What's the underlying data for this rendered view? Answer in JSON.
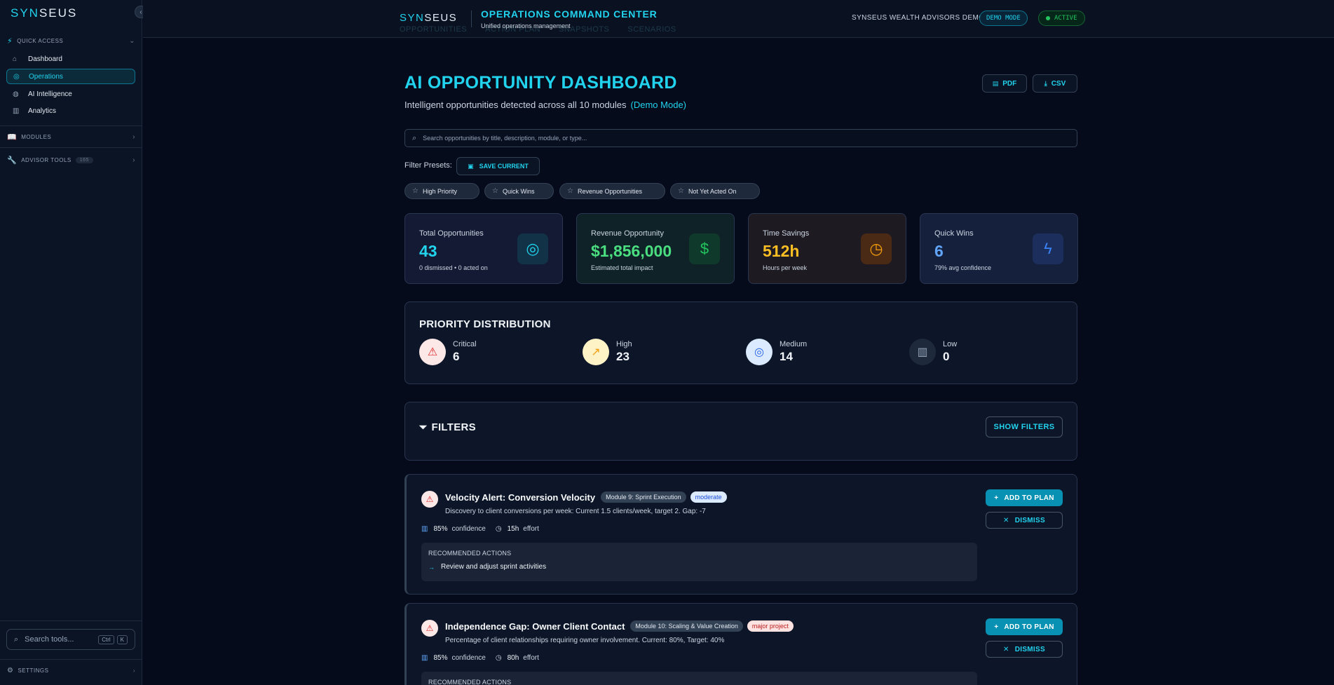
{
  "sidebar": {
    "brand_a": "SYN",
    "brand_b": "SEUS",
    "quick_access": "QUICK ACCESS",
    "items": [
      {
        "label": "Dashboard",
        "icon": "home-icon"
      },
      {
        "label": "Operations",
        "icon": "target-icon",
        "active": true
      },
      {
        "label": "AI Intelligence",
        "icon": "brain-icon"
      },
      {
        "label": "Analytics",
        "icon": "bar-chart-icon"
      }
    ],
    "modules": "MODULES",
    "advisor_tools": "ADVISOR TOOLS",
    "advisor_tools_count": "165",
    "search_placeholder": "Search tools...",
    "kbd_ctrl": "Ctrl",
    "kbd_k": "K",
    "settings": "SETTINGS"
  },
  "topbar": {
    "brand_a": "SYN",
    "brand_b": "SEUS",
    "title": "OPERATIONS COMMAND CENTER",
    "subtitle": "Unified operations management",
    "ghost_tabs": [
      "OPPORTUNITIES",
      "ACTION PLAN",
      "SNAPSHOTS",
      "SCENARIOS"
    ],
    "org_name": "SYNSEUS WEALTH ADVISORS DEMO",
    "demo_mode": "DEMO MODE",
    "status": "ACTIVE"
  },
  "main": {
    "title": "AI OPPORTUNITY DASHBOARD",
    "subtitle": "Intelligent opportunities detected across all 10 modules",
    "demo_tag": "(Demo Mode)",
    "export_pdf": "PDF",
    "export_csv": "CSV",
    "search_placeholder": "Search opportunities by title, description, module, or type...",
    "presets_label": "Filter Presets:",
    "save_current": "SAVE CURRENT",
    "presets": [
      "High Priority",
      "Quick Wins",
      "Revenue Opportunities",
      "Not Yet Acted On"
    ]
  },
  "stats": [
    {
      "label": "Total Opportunities",
      "value": "43",
      "sub": "0 dismissed • 0 acted on",
      "icon": "target-icon"
    },
    {
      "label": "Revenue Opportunity",
      "value": "$1,856,000",
      "sub": "Estimated total impact",
      "icon": "dollar-icon"
    },
    {
      "label": "Time Savings",
      "value": "512h",
      "sub": "Hours per week",
      "icon": "clock-icon"
    },
    {
      "label": "Quick Wins",
      "value": "6",
      "sub": "79% avg confidence",
      "icon": "lightning-icon"
    }
  ],
  "priority": {
    "title": "PRIORITY DISTRIBUTION",
    "items": [
      {
        "label": "Critical",
        "value": "6",
        "icon": "alert-triangle-icon"
      },
      {
        "label": "High",
        "value": "23",
        "icon": "trending-up-icon"
      },
      {
        "label": "Medium",
        "value": "14",
        "icon": "target-icon"
      },
      {
        "label": "Low",
        "value": "0",
        "icon": "bar-chart-icon"
      }
    ]
  },
  "filters": {
    "title": "FILTERS",
    "show_button": "SHOW FILTERS"
  },
  "opportunities": [
    {
      "title": "Velocity Alert: Conversion Velocity",
      "module": "Module 9: Sprint Execution",
      "effort_tag": "moderate",
      "description": "Discovery to client conversions per week: Current 1.5 clients/week, target 2. Gap: -7",
      "confidence": "85%",
      "confidence_label": "confidence",
      "effort": "15h",
      "effort_label": "effort",
      "rec_title": "RECOMMENDED ACTIONS",
      "rec_item": "Review and adjust sprint activities",
      "add_label": "ADD TO PLAN",
      "dismiss_label": "DISMISS"
    },
    {
      "title": "Independence Gap: Owner Client Contact",
      "module": "Module 10: Scaling & Value Creation",
      "effort_tag": "major project",
      "description": "Percentage of client relationships requiring owner involvement. Current: 80%, Target: 40%",
      "confidence": "85%",
      "confidence_label": "confidence",
      "effort": "80h",
      "effort_label": "effort",
      "rec_title": "RECOMMENDED ACTIONS",
      "add_label": "ADD TO PLAN",
      "dismiss_label": "DISMISS"
    }
  ],
  "colors": {
    "accent": "#22d3ee",
    "critical": "#dc2626",
    "high": "#f59e0b",
    "medium": "#3b82f6",
    "success": "#22c55e"
  }
}
